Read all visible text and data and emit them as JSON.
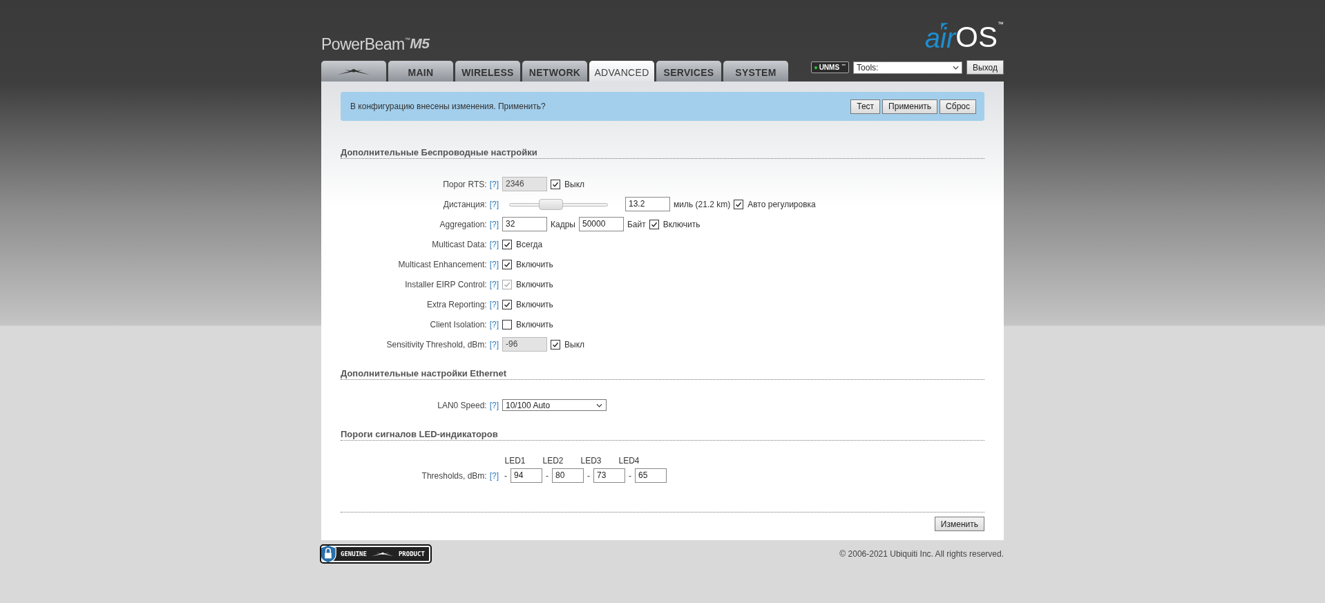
{
  "header": {
    "product": "PowerBeam",
    "product_tm": "™",
    "product_model": "M5",
    "brand_air": "air",
    "brand_os": "OS",
    "brand_tm": "™"
  },
  "tabs": [
    {
      "kind": "logo",
      "selected": false
    },
    {
      "kind": "text",
      "label": "MAIN",
      "selected": false
    },
    {
      "kind": "text",
      "label": "WIRELESS",
      "selected": false
    },
    {
      "kind": "text",
      "label": "NETWORK",
      "selected": false
    },
    {
      "kind": "text",
      "label": "ADVANCED",
      "selected": true
    },
    {
      "kind": "text",
      "label": "SERVICES",
      "selected": false
    },
    {
      "kind": "text",
      "label": "SYSTEM",
      "selected": false
    }
  ],
  "toolbar": {
    "unms": "UNMS",
    "unms_tm": "™",
    "tools": "Tools:",
    "logout": "Выход"
  },
  "notice": {
    "text": "В конфигурацию внесены изменения. Применить?",
    "buttons": [
      "Тест",
      "Применить",
      "Сброс"
    ]
  },
  "sections": [
    {
      "title": "Дополнительные Беспроводные настройки",
      "rows": [
        {
          "label": "Порог RTS:",
          "help": "[?]",
          "controls": [
            {
              "kind": "input",
              "value": "2346",
              "disabled": true
            },
            {
              "kind": "checkbox",
              "checked": true,
              "disabled": false,
              "label": "Выкл"
            }
          ]
        },
        {
          "label": "Дистанция:",
          "help": "[?]",
          "controls": [
            {
              "kind": "slider",
              "level": 0.4
            },
            {
              "kind": "input",
              "value": "13.2",
              "disabled": false
            },
            {
              "kind": "text",
              "text": "миль (21.2 km)"
            },
            {
              "kind": "checkbox",
              "checked": true,
              "disabled": false,
              "label": "Авто регулировка"
            }
          ]
        },
        {
          "label": "Aggregation:",
          "help": "[?]",
          "controls": [
            {
              "kind": "input",
              "value": "32",
              "disabled": false
            },
            {
              "kind": "text",
              "text": "Кадры"
            },
            {
              "kind": "input",
              "value": "50000",
              "disabled": false
            },
            {
              "kind": "text",
              "text": "Байт"
            },
            {
              "kind": "checkbox",
              "checked": true,
              "disabled": false,
              "label": "Включить"
            }
          ]
        },
        {
          "label": "Multicast Data:",
          "help": "[?]",
          "controls": [
            {
              "kind": "checkbox",
              "checked": true,
              "disabled": false,
              "label": "Всегда"
            }
          ]
        },
        {
          "label": "Multicast Enhancement:",
          "help": "[?]",
          "controls": [
            {
              "kind": "checkbox",
              "checked": true,
              "disabled": false,
              "label": "Включить"
            }
          ]
        },
        {
          "label": "Installer EIRP Control:",
          "help": "[?]",
          "controls": [
            {
              "kind": "checkbox",
              "checked": true,
              "disabled": true,
              "label": "Включить"
            }
          ]
        },
        {
          "label": "Extra Reporting:",
          "help": "[?]",
          "controls": [
            {
              "kind": "checkbox",
              "checked": true,
              "disabled": false,
              "label": "Включить"
            }
          ]
        },
        {
          "label": "Client Isolation:",
          "help": "[?]",
          "controls": [
            {
              "kind": "checkbox",
              "checked": false,
              "disabled": false,
              "label": "Включить"
            }
          ]
        },
        {
          "label": "Sensitivity Threshold, dBm:",
          "help": "[?]",
          "controls": [
            {
              "kind": "input",
              "value": "-96",
              "disabled": true
            },
            {
              "kind": "checkbox",
              "checked": true,
              "disabled": false,
              "label": "Выкл"
            }
          ]
        }
      ]
    },
    {
      "title": "Дополнительные настройки Ethernet",
      "rows": [
        {
          "label": "LAN0 Speed:",
          "help": "[?]",
          "controls": [
            {
              "kind": "select",
              "value": "10/100 Auto"
            }
          ]
        }
      ]
    },
    {
      "title": "Пороги сигналов LED-индикаторов",
      "leds": {
        "headers": [
          "LED1",
          "LED2",
          "LED3",
          "LED4"
        ],
        "label": "Thresholds, dBm:",
        "help": "[?]",
        "fields": [
          {
            "sign": "-",
            "value": "94"
          },
          {
            "sign": "-",
            "value": "80"
          },
          {
            "sign": "-",
            "value": "73"
          },
          {
            "sign": "-",
            "value": "65"
          }
        ]
      }
    }
  ],
  "submit": "Изменить",
  "footer": {
    "badge_left": "GENUINE",
    "badge_right": "PRODUCT",
    "copyright": "© 2006-2021 Ubiquiti Inc. All rights reserved."
  }
}
